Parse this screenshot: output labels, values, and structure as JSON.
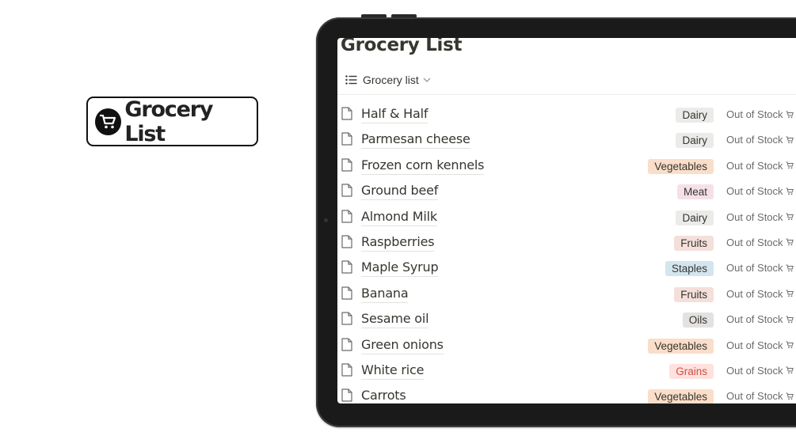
{
  "badge": {
    "text": "Grocery List",
    "icon": "shopping-cart-icon"
  },
  "page": {
    "title": "Grocery List"
  },
  "view": {
    "label": "Grocery list",
    "icon": "list-icon"
  },
  "items": [
    {
      "name": "Half & Half",
      "category": "Dairy",
      "status": "Out of Stock"
    },
    {
      "name": "Parmesan cheese",
      "category": "Dairy",
      "status": "Out of Stock"
    },
    {
      "name": "Frozen corn kennels",
      "category": "Vegetables",
      "status": "Out of Stock"
    },
    {
      "name": "Ground beef",
      "category": "Meat",
      "status": "Out of Stock"
    },
    {
      "name": "Almond Milk",
      "category": "Dairy",
      "status": "Out of Stock"
    },
    {
      "name": "Raspberries",
      "category": "Fruits",
      "status": "Out of Stock"
    },
    {
      "name": "Maple Syrup",
      "category": "Staples",
      "status": "Out of Stock"
    },
    {
      "name": "Banana",
      "category": "Fruits",
      "status": "Out of Stock"
    },
    {
      "name": "Sesame oil",
      "category": "Oils",
      "status": "Out of Stock"
    },
    {
      "name": "Green onions",
      "category": "Vegetables",
      "status": "Out of Stock"
    },
    {
      "name": "White rice",
      "category": "Grains",
      "status": "Out of Stock"
    },
    {
      "name": "Carrots",
      "category": "Vegetables",
      "status": "Out of Stock"
    }
  ],
  "category_colors": {
    "Dairy": "#ebebea",
    "Vegetables": "#fadec9",
    "Meat": "#f5e0e9",
    "Fruits": "#f4dfdb",
    "Staples": "#d3e5ef",
    "Oils": "#e3e2e0",
    "Grains": "#ffe2dd"
  },
  "category_text_colors": {
    "Dairy": "#37352f",
    "Vegetables": "#37352f",
    "Meat": "#37352f",
    "Fruits": "#37352f",
    "Staples": "#37352f",
    "Oils": "#37352f",
    "Grains": "#d44c47"
  }
}
